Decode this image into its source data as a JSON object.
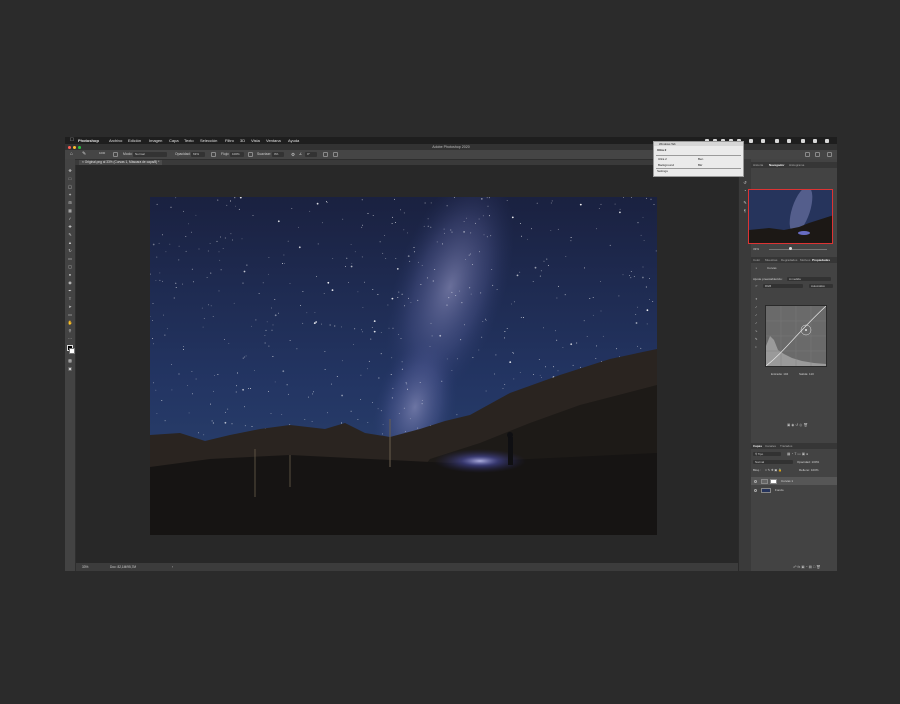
{
  "menubar": {
    "app_name": "Photoshop",
    "items": [
      "Archivo",
      "Edición",
      "Imagen",
      "Capa",
      "Texto",
      "Selección",
      "Filtro",
      "3D",
      "Vista",
      "Ventana",
      "Ayuda"
    ]
  },
  "window": {
    "title": "Adobe Photoshop 2020"
  },
  "options_bar": {
    "brush_size": "1000",
    "mode_label": "Modo:",
    "mode_value": "Normal",
    "opacity_label": "Opacidad:",
    "opacity_value": "63%",
    "flow_label": "Flujo:",
    "flow_value": "100%",
    "smoothing_label": "Suavizar:",
    "smoothing_value": "0%",
    "angle_value": "0°"
  },
  "document": {
    "tab_title": "Original.png al 33% (Curvas 1, Máscara de capa/8) *",
    "zoom": "33%",
    "doc_info": "Doc: 82,1M/95,7M"
  },
  "info_panel": {
    "header": "Windows Tab",
    "title": "Ultra 2",
    "row1_left": "Ultra 2",
    "row1_right": "Ben",
    "row2_left": "Background",
    "row2_right": "Bkr",
    "footer": "Settings"
  },
  "panels": {
    "top_tabs": [
      "Historia",
      "Navegador",
      "Histograma"
    ],
    "navigator_zoom": "33%",
    "props_tabs": [
      "Color",
      "Muestras",
      "Degradados",
      "Motivos",
      "Propiedades"
    ],
    "props_title": "Curvas",
    "preset_label": "Ajuste preestablecido:",
    "preset_value": "A medida",
    "channel_value": "RGB",
    "auto_label": "Automático",
    "input_label": "Entrada:",
    "input_value": "104",
    "output_label": "Salida:",
    "output_value": "110",
    "layers_tabs": [
      "Capas",
      "Canales",
      "Trazados"
    ],
    "kind_value": "Tipo",
    "blend_mode": "Normal",
    "opacity_label": "Opacidad:",
    "opacity_value": "100%",
    "lock_label": "Bloq.:",
    "fill_label": "Relleno:",
    "fill_value": "100%",
    "layers": [
      {
        "name": "Curvas 1"
      },
      {
        "name": "Fondo"
      }
    ]
  },
  "colors": {
    "background": "#2b2b2b",
    "ps_dark": "#1e1e1e",
    "panel": "#434343",
    "navigator_border": "#dd3333",
    "close_light": "#ff5f57",
    "min_light": "#febc2e",
    "max_light": "#28c840"
  }
}
